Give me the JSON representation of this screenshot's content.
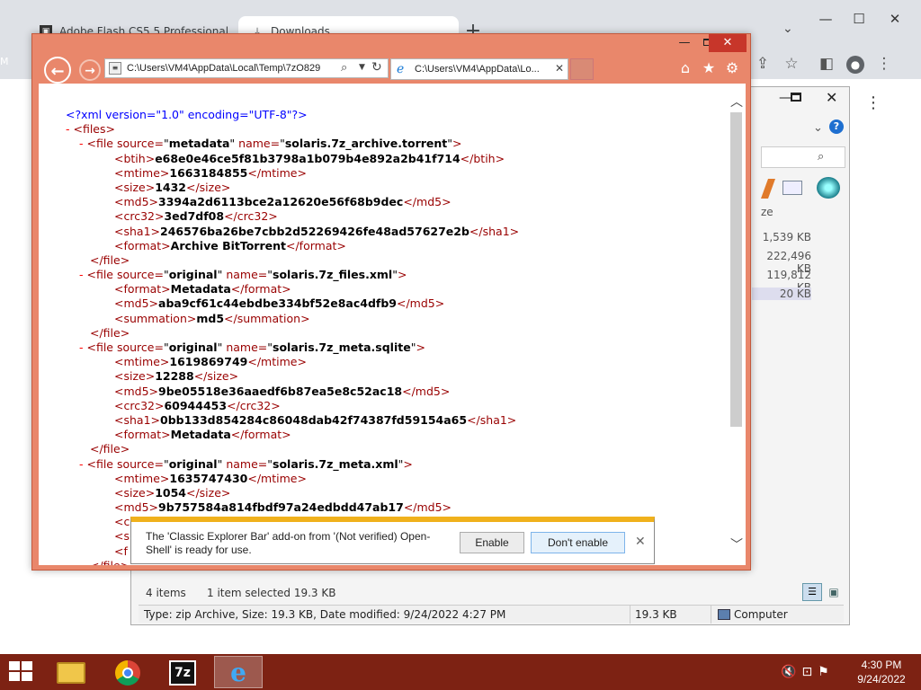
{
  "chrome": {
    "tab1_title": "Adobe Flash CS5.5 Professional",
    "tab1_icon": "adobe-icon",
    "tab2_title": "Downloads",
    "tab2_icon": "download-icon",
    "new_tab": "+",
    "left_edge_m": "M",
    "left_edge_d": "D"
  },
  "explorer": {
    "column_header": "ze",
    "sizes": [
      "1,539 KB",
      "222,496 KB",
      "119,812 KB",
      "20 KB"
    ],
    "status_items": "4 items",
    "status_selected": "1 item selected  19.3 KB",
    "details_type": "Type: zip Archive, Size: 19.3 KB, Date modified: 9/24/2022 4:27 PM",
    "details_size": "19.3 KB",
    "details_location": "Computer"
  },
  "ie": {
    "address": "C:\\Users\\VM4\\AppData\\Local\\Temp\\7zO829",
    "tab_title": "C:\\Users\\VM4\\AppData\\Lo...",
    "xml_decl": "<?xml version=\"1.0\" encoding=\"UTF-8\"?>",
    "files_open": "<files>",
    "files": [
      {
        "source": "metadata",
        "name": "solaris.7z_archive.torrent",
        "children": [
          {
            "tag": "btih",
            "value": "e68e0e46ce5f81b3798a1b079b4e892a2b41f714"
          },
          {
            "tag": "mtime",
            "value": "1663184855"
          },
          {
            "tag": "size",
            "value": "1432"
          },
          {
            "tag": "md5",
            "value": "3394a2d6113bce2a12620e56f68b9dec"
          },
          {
            "tag": "crc32",
            "value": "3ed7df08"
          },
          {
            "tag": "sha1",
            "value": "246576ba26be7cbb2d52269426fe48ad57627e2b"
          },
          {
            "tag": "format",
            "value": "Archive BitTorrent"
          }
        ]
      },
      {
        "source": "original",
        "name": "solaris.7z_files.xml",
        "children": [
          {
            "tag": "format",
            "value": "Metadata"
          },
          {
            "tag": "md5",
            "value": "aba9cf61c44ebdbe334bf52e8ac4dfb9"
          },
          {
            "tag": "summation",
            "value": "md5"
          }
        ]
      },
      {
        "source": "original",
        "name": "solaris.7z_meta.sqlite",
        "children": [
          {
            "tag": "mtime",
            "value": "1619869749"
          },
          {
            "tag": "size",
            "value": "12288"
          },
          {
            "tag": "md5",
            "value": "9be05518e36aaedf6b87ea5e8c52ac18"
          },
          {
            "tag": "crc32",
            "value": "60944453"
          },
          {
            "tag": "sha1",
            "value": "0bb133d854284c86048dab42f74387fd59154a65"
          },
          {
            "tag": "format",
            "value": "Metadata"
          }
        ]
      },
      {
        "source": "original",
        "name": "solaris.7z_meta.xml",
        "children": [
          {
            "tag": "mtime",
            "value": "1635747430"
          },
          {
            "tag": "size",
            "value": "1054"
          },
          {
            "tag": "md5",
            "value": "9b757584a814fbdf97a24edbdd47ab17"
          }
        ],
        "truncated": [
          "<c",
          "<s",
          "<f",
          "</file>"
        ]
      }
    ]
  },
  "notification": {
    "message": "The 'Classic Explorer Bar' add-on from '(Not verified) Open-Shell' is ready for use.",
    "enable": "Enable",
    "dont_enable": "Don't enable"
  },
  "taskbar": {
    "time": "4:30 PM",
    "date": "9/24/2022"
  }
}
